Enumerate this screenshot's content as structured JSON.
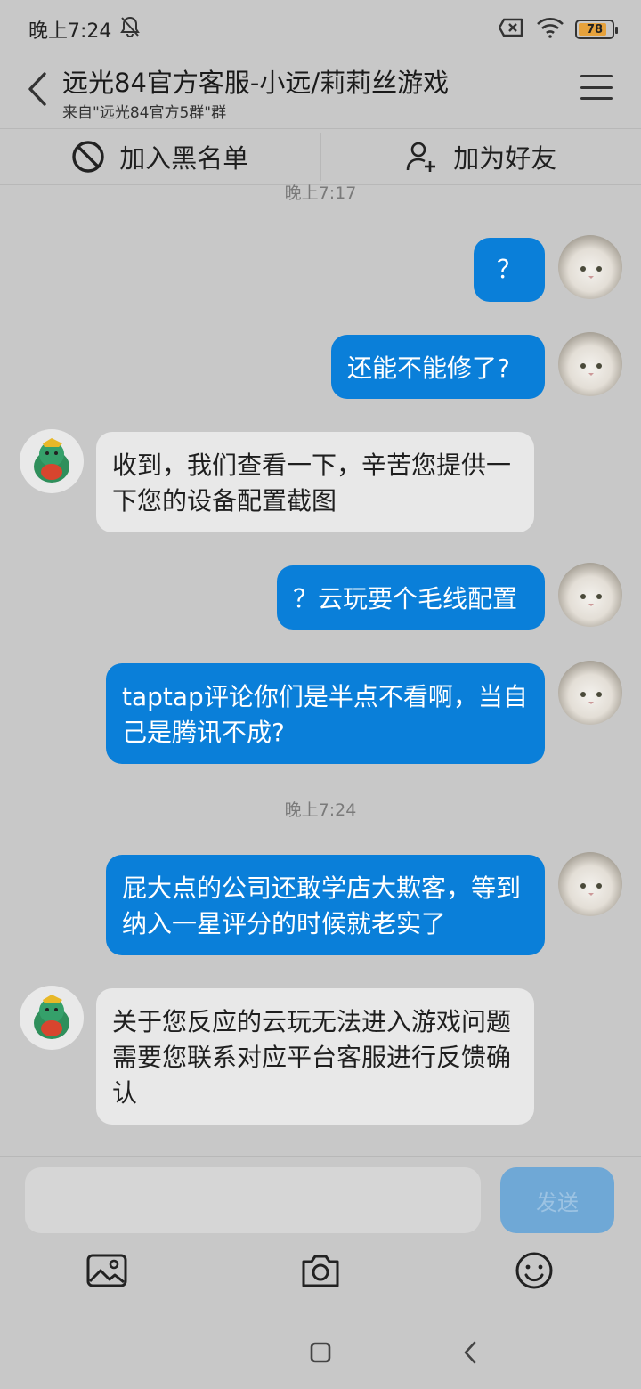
{
  "status_bar": {
    "time": "晚上7:24",
    "battery_level": "78",
    "icons": [
      "bell-off-icon",
      "sim-x-icon",
      "wifi-icon",
      "battery-icon"
    ]
  },
  "header": {
    "title": "远光84官方客服-小远/莉莉丝游戏",
    "subtitle": "来自\"远光84官方5群\"群"
  },
  "actions": {
    "blacklist_label": "加入黑名单",
    "add_friend_label": "加为好友"
  },
  "chat": {
    "timestamps": [
      "晚上7:17",
      "晚上7:24"
    ],
    "messages": [
      {
        "side": "out",
        "text": "？"
      },
      {
        "side": "out",
        "text": "还能不能修了?"
      },
      {
        "side": "in",
        "text": "收到，我们查看一下，辛苦您提供一下您的设备配置截图"
      },
      {
        "side": "out",
        "text": "？云玩要个毛线配置"
      },
      {
        "side": "out",
        "text": "taptap评论你们是半点不看啊，当自己是腾讯不成?"
      },
      {
        "side": "out",
        "text": "屁大点的公司还敢学店大欺客，等到纳入一星评分的时候就老实了"
      },
      {
        "side": "in",
        "text": "关于您反应的云玩无法进入游戏问题需要您联系对应平台客服进行反馈确认"
      }
    ]
  },
  "input": {
    "value": "",
    "placeholder": "",
    "send_label": "发送"
  },
  "colors": {
    "outgoing_bubble": "#0a7fd9",
    "incoming_bubble": "#e8e8e8",
    "background": "#c8c8c8",
    "send_button": "#6fa8d6"
  }
}
